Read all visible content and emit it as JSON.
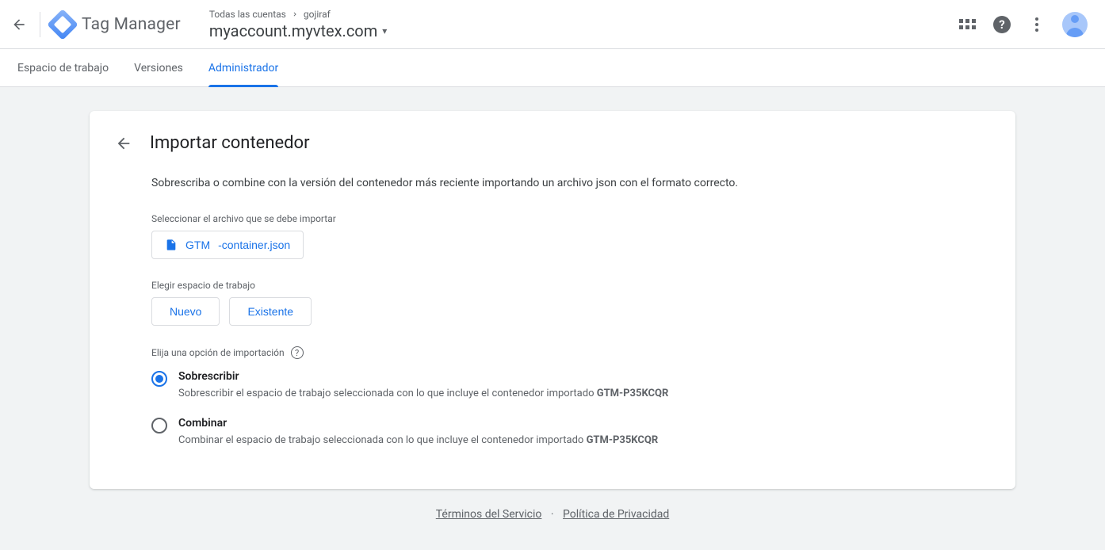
{
  "header": {
    "product_name": "Tag Manager",
    "breadcrumb_accounts": "Todas las cuentas",
    "breadcrumb_account": "gojiraf",
    "container_name": "myaccount.myvtex.com"
  },
  "tabs": {
    "workspace": "Espacio de trabajo",
    "versions": "Versiones",
    "admin": "Administrador"
  },
  "card": {
    "title": "Importar contenedor",
    "description": "Sobrescriba o combine con la versión del contenedor más reciente importando un archivo json con el formato correcto.",
    "file_label": "Seleccionar el archivo que se debe importar",
    "file_name_prefix": "GTM",
    "file_name_suffix": "-container.json",
    "workspace_label": "Elegir espacio de trabajo",
    "btn_new": "Nuevo",
    "btn_existing": "Existente",
    "import_option_label": "Elija una opción de importación",
    "overwrite": {
      "title": "Sobrescribir",
      "desc_text": "Sobrescribir el espacio de trabajo seleccionada con lo que incluye el contenedor importado ",
      "container_id": "GTM-P35KCQR"
    },
    "merge": {
      "title": "Combinar",
      "desc_text": "Combinar el espacio de trabajo seleccionada con lo que incluye el contenedor importado ",
      "container_id": "GTM-P35KCQR"
    }
  },
  "footer": {
    "terms": "Términos del Servicio",
    "privacy": "Política de Privacidad"
  }
}
